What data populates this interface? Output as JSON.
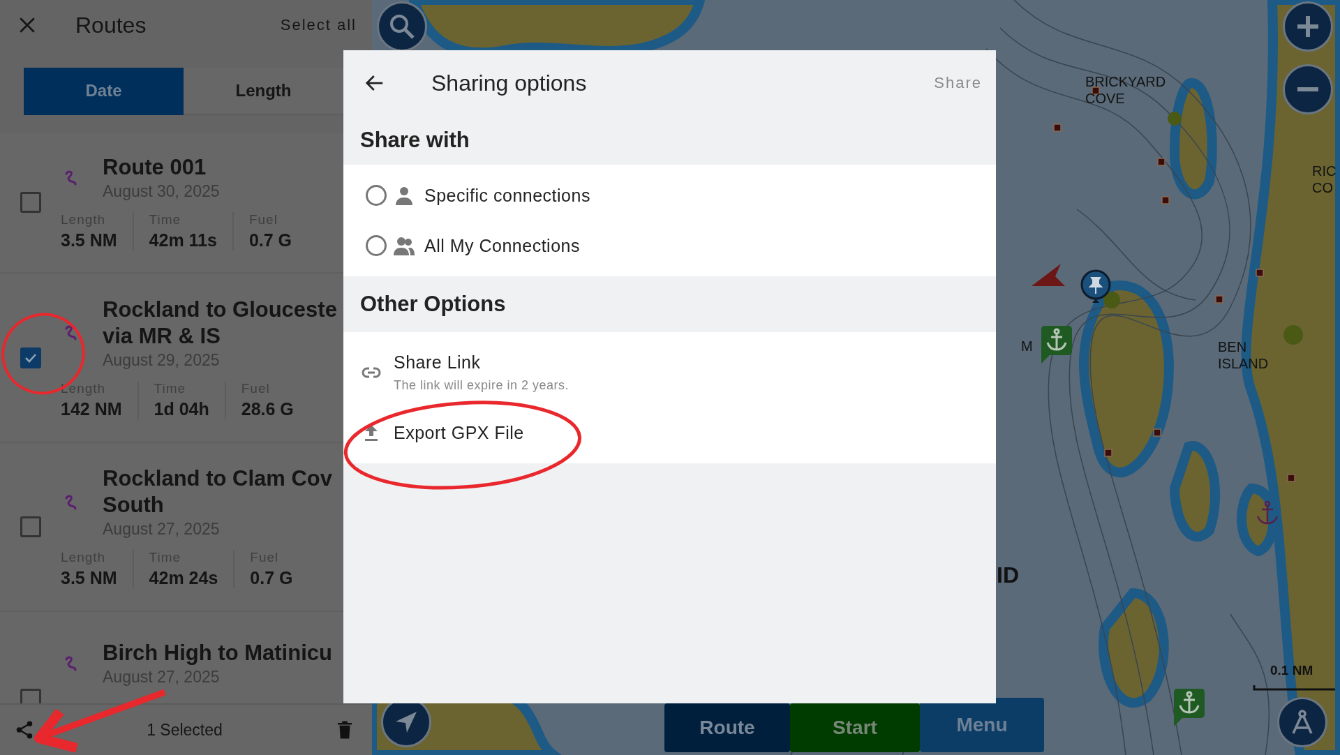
{
  "routes_panel": {
    "title": "Routes",
    "select_all": "Select all",
    "sort_tabs": [
      {
        "label": "Date",
        "selected": true
      },
      {
        "label": "Length",
        "selected": false
      }
    ],
    "routes": [
      {
        "name_lines": [
          "Route 001"
        ],
        "date": "August 30, 2025",
        "checked": false,
        "stats": [
          {
            "label": "Length",
            "value": "3.5 NM"
          },
          {
            "label": "Time",
            "value": "42m 11s"
          },
          {
            "label": "Fuel",
            "value": "0.7 G"
          }
        ]
      },
      {
        "name_lines": [
          "Rockland to Glouceste",
          "via MR & IS"
        ],
        "date": "August 29, 2025",
        "checked": true,
        "stats": [
          {
            "label": "Length",
            "value": "142 NM"
          },
          {
            "label": "Time",
            "value": "1d 04h"
          },
          {
            "label": "Fuel",
            "value": "28.6 G"
          }
        ]
      },
      {
        "name_lines": [
          "Rockland to Clam Cov",
          "South"
        ],
        "date": "August 27, 2025",
        "checked": false,
        "stats": [
          {
            "label": "Length",
            "value": "3.5 NM"
          },
          {
            "label": "Time",
            "value": "42m 24s"
          },
          {
            "label": "Fuel",
            "value": "0.7 G"
          }
        ]
      },
      {
        "name_lines": [
          "Birch High to Matinicu"
        ],
        "date": "August 27, 2025",
        "checked": false
      }
    ],
    "selection_bar": {
      "count": "1 Selected"
    }
  },
  "sharing_dialog": {
    "title": "Sharing options",
    "action": "Share",
    "sections": [
      {
        "heading": "Share with",
        "options": [
          {
            "kind": "radio",
            "label": "Specific connections",
            "selected": false
          },
          {
            "kind": "radio",
            "label": "All My Connections",
            "selected": false
          }
        ]
      },
      {
        "heading": "Other Options",
        "options": [
          {
            "kind": "action",
            "label": "Share Link",
            "subtitle": "The link will expire in 2 years."
          },
          {
            "kind": "action",
            "label": "Export GPX File"
          }
        ]
      }
    ]
  },
  "map": {
    "labels": [
      {
        "lines": [
          "BRICKYARD",
          "COVE"
        ]
      },
      {
        "lines": [
          "RIC",
          "CO"
        ]
      },
      {
        "lines": [
          "M"
        ]
      },
      {
        "lines": [
          "BEN",
          "ISLAND"
        ]
      },
      {
        "lines": [
          "ID"
        ]
      }
    ],
    "scale": "0.1 NM",
    "actions": [
      {
        "label": "Route"
      },
      {
        "label": "Start"
      },
      {
        "label": "Menu"
      }
    ]
  }
}
